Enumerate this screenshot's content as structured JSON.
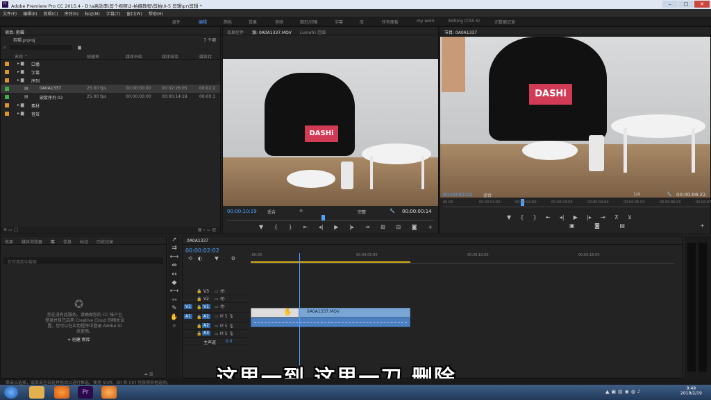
{
  "app": {
    "title": "Adobe Premiere Pro CC 2015.4 - D:\\a高効率\\剪个视频\\2-拍摄教程\\剪拍\\0-5 剪辑\\pr\\剪辑 *",
    "icon": "Pr"
  },
  "window_controls": [
    "–",
    "□",
    "✕"
  ],
  "menu": [
    "文件(F)",
    "编辑(E)",
    "剪辑(C)",
    "序列(S)",
    "标记(M)",
    "字幕(T)",
    "窗口(W)",
    "帮助(H)"
  ],
  "workspaces": [
    "组件",
    "编辑",
    "颜色",
    "效果",
    "音频",
    "图形/印象",
    "字幕",
    "库",
    "所有面板",
    "my work",
    "Editing (CS5.5)",
    "元数据记录"
  ],
  "active_workspace": "编辑",
  "project": {
    "tab": "项目: 剪辑",
    "file": "剪辑.prproj",
    "count": "7 个项",
    "columns": [
      "名称 ^",
      "帧速率",
      "媒体开始",
      "媒体结束",
      "媒体持"
    ],
    "rows": [
      {
        "name": "口播",
        "color": "#e0952a",
        "fps": "",
        "start": "",
        "end": "",
        "dur": ""
      },
      {
        "name": "字幕",
        "color": "#e0952a",
        "fps": "",
        "start": "",
        "end": "",
        "dur": ""
      },
      {
        "name": "序列",
        "color": "#e0952a",
        "fps": "",
        "start": "",
        "end": "",
        "dur": ""
      },
      {
        "name": "0A0A1337",
        "color": "#3fae4c",
        "fps": "25.00 fps",
        "start": "00:00:00:00",
        "end": "00:02:26:05",
        "dur": "00:02:2"
      },
      {
        "name": "嵌套序列 02",
        "color": "#3fae4c",
        "fps": "25.00 fps",
        "start": "00:00:00:00",
        "end": "00:00:14:18",
        "dur": "00:00:1"
      },
      {
        "name": "素材",
        "color": "#e0952a",
        "fps": "",
        "start": "",
        "end": "",
        "dur": ""
      },
      {
        "name": "音效",
        "color": "#e0952a",
        "fps": "",
        "start": "",
        "end": "",
        "dur": ""
      }
    ]
  },
  "source_monitor": {
    "tabs": [
      "效果控件",
      "源: 0A0A1337.MOV",
      "Lumetri 范围"
    ],
    "timecode": "00:00:10:19",
    "fit": "适合",
    "quality": "完整",
    "duration": "00:00:00:14"
  },
  "program_monitor": {
    "tab": "节目: 0A0A1337",
    "timecode": "00:00:02:02",
    "fit": "适合",
    "quality": "1/4",
    "duration": "00:00:06:22",
    "ruler": [
      "00:00",
      "00:00:01:00",
      "00:00:02:00",
      "00:00:03:00",
      "00:00:04:00",
      "00:00:05:00",
      "00:00:06:00",
      "00:00:07:00"
    ]
  },
  "shirt_brand": "DASHi",
  "bottom_left": {
    "tabs": [
      "效果",
      "媒体浏览器",
      "库",
      "信息",
      "标记",
      "历史记录"
    ],
    "search_placeholder": "在可用库中搜索",
    "cc_message": "您在没有此服务。请确保您的 CC 帐户已登录并且已启用 Creative Cloud 的相关设置。您可以在应用程序中登录 Adobe ID 来使用。",
    "create_button": "+ 创建 新库"
  },
  "timeline": {
    "tab": "0A0A1337",
    "timecode": "00:00:02:02",
    "ruler": [
      ":00:00",
      "00:00:05:00",
      "00:00:10:00",
      "00:00:15:00"
    ],
    "video_tracks": [
      "V3",
      "V2",
      "V1"
    ],
    "audio_tracks": [
      "A1",
      "A2",
      "A3"
    ],
    "master": "主声道",
    "master_val": "0.0",
    "clip_name": "0A0A1337.MOV",
    "src_v": "V1",
    "src_a": "A1"
  },
  "subtitle": "这里一到 这里一刀 删除",
  "status": "单击以选择，或单击空白处并拖动以进行框选。使用 Shift、Alt 和 Ctrl 可获得其他选项。",
  "clock": {
    "time": "9:49",
    "date": "2019/2/19"
  }
}
